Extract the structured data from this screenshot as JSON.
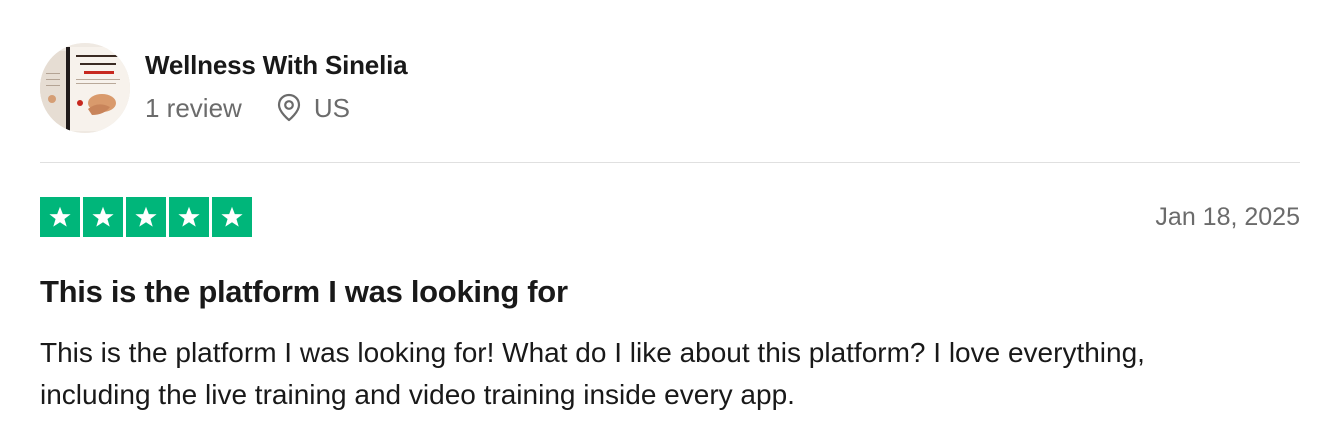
{
  "consumer": {
    "name": "Wellness With Sinelia",
    "reviews": "1 review",
    "country": "US"
  },
  "review": {
    "rating": 5,
    "max_rating": 5,
    "date": "Jan 18, 2025",
    "title": "This is the platform I was looking for",
    "body": "This is the platform I was looking for! What do I like about this platform? I love everything, including the live training and video training inside every app."
  },
  "colors": {
    "star_green": "#00b67a",
    "text_primary": "#191919",
    "text_secondary": "#6b6b6b",
    "divider": "#e0e0e0"
  },
  "icons": {
    "location": "location-pin-icon",
    "star": "star-icon"
  }
}
